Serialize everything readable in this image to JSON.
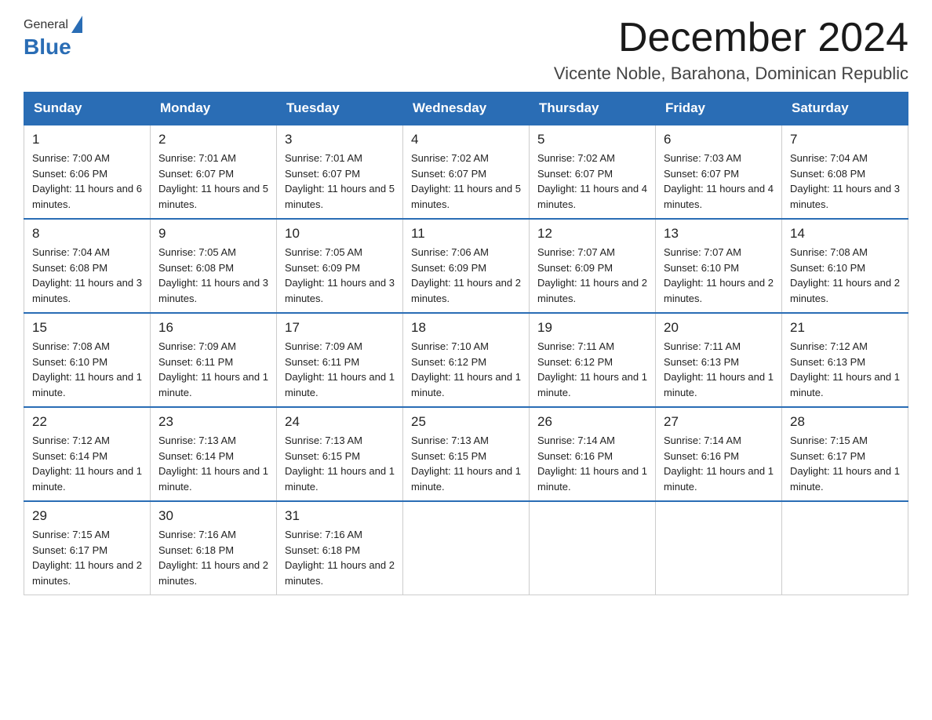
{
  "header": {
    "logo_general": "General",
    "logo_blue": "Blue",
    "month_title": "December 2024",
    "location": "Vicente Noble, Barahona, Dominican Republic"
  },
  "days_of_week": [
    "Sunday",
    "Monday",
    "Tuesday",
    "Wednesday",
    "Thursday",
    "Friday",
    "Saturday"
  ],
  "weeks": [
    [
      {
        "day": "1",
        "sunrise": "7:00 AM",
        "sunset": "6:06 PM",
        "daylight": "11 hours and 6 minutes."
      },
      {
        "day": "2",
        "sunrise": "7:01 AM",
        "sunset": "6:07 PM",
        "daylight": "11 hours and 5 minutes."
      },
      {
        "day": "3",
        "sunrise": "7:01 AM",
        "sunset": "6:07 PM",
        "daylight": "11 hours and 5 minutes."
      },
      {
        "day": "4",
        "sunrise": "7:02 AM",
        "sunset": "6:07 PM",
        "daylight": "11 hours and 5 minutes."
      },
      {
        "day": "5",
        "sunrise": "7:02 AM",
        "sunset": "6:07 PM",
        "daylight": "11 hours and 4 minutes."
      },
      {
        "day": "6",
        "sunrise": "7:03 AM",
        "sunset": "6:07 PM",
        "daylight": "11 hours and 4 minutes."
      },
      {
        "day": "7",
        "sunrise": "7:04 AM",
        "sunset": "6:08 PM",
        "daylight": "11 hours and 3 minutes."
      }
    ],
    [
      {
        "day": "8",
        "sunrise": "7:04 AM",
        "sunset": "6:08 PM",
        "daylight": "11 hours and 3 minutes."
      },
      {
        "day": "9",
        "sunrise": "7:05 AM",
        "sunset": "6:08 PM",
        "daylight": "11 hours and 3 minutes."
      },
      {
        "day": "10",
        "sunrise": "7:05 AM",
        "sunset": "6:09 PM",
        "daylight": "11 hours and 3 minutes."
      },
      {
        "day": "11",
        "sunrise": "7:06 AM",
        "sunset": "6:09 PM",
        "daylight": "11 hours and 2 minutes."
      },
      {
        "day": "12",
        "sunrise": "7:07 AM",
        "sunset": "6:09 PM",
        "daylight": "11 hours and 2 minutes."
      },
      {
        "day": "13",
        "sunrise": "7:07 AM",
        "sunset": "6:10 PM",
        "daylight": "11 hours and 2 minutes."
      },
      {
        "day": "14",
        "sunrise": "7:08 AM",
        "sunset": "6:10 PM",
        "daylight": "11 hours and 2 minutes."
      }
    ],
    [
      {
        "day": "15",
        "sunrise": "7:08 AM",
        "sunset": "6:10 PM",
        "daylight": "11 hours and 1 minute."
      },
      {
        "day": "16",
        "sunrise": "7:09 AM",
        "sunset": "6:11 PM",
        "daylight": "11 hours and 1 minute."
      },
      {
        "day": "17",
        "sunrise": "7:09 AM",
        "sunset": "6:11 PM",
        "daylight": "11 hours and 1 minute."
      },
      {
        "day": "18",
        "sunrise": "7:10 AM",
        "sunset": "6:12 PM",
        "daylight": "11 hours and 1 minute."
      },
      {
        "day": "19",
        "sunrise": "7:11 AM",
        "sunset": "6:12 PM",
        "daylight": "11 hours and 1 minute."
      },
      {
        "day": "20",
        "sunrise": "7:11 AM",
        "sunset": "6:13 PM",
        "daylight": "11 hours and 1 minute."
      },
      {
        "day": "21",
        "sunrise": "7:12 AM",
        "sunset": "6:13 PM",
        "daylight": "11 hours and 1 minute."
      }
    ],
    [
      {
        "day": "22",
        "sunrise": "7:12 AM",
        "sunset": "6:14 PM",
        "daylight": "11 hours and 1 minute."
      },
      {
        "day": "23",
        "sunrise": "7:13 AM",
        "sunset": "6:14 PM",
        "daylight": "11 hours and 1 minute."
      },
      {
        "day": "24",
        "sunrise": "7:13 AM",
        "sunset": "6:15 PM",
        "daylight": "11 hours and 1 minute."
      },
      {
        "day": "25",
        "sunrise": "7:13 AM",
        "sunset": "6:15 PM",
        "daylight": "11 hours and 1 minute."
      },
      {
        "day": "26",
        "sunrise": "7:14 AM",
        "sunset": "6:16 PM",
        "daylight": "11 hours and 1 minute."
      },
      {
        "day": "27",
        "sunrise": "7:14 AM",
        "sunset": "6:16 PM",
        "daylight": "11 hours and 1 minute."
      },
      {
        "day": "28",
        "sunrise": "7:15 AM",
        "sunset": "6:17 PM",
        "daylight": "11 hours and 1 minute."
      }
    ],
    [
      {
        "day": "29",
        "sunrise": "7:15 AM",
        "sunset": "6:17 PM",
        "daylight": "11 hours and 2 minutes."
      },
      {
        "day": "30",
        "sunrise": "7:16 AM",
        "sunset": "6:18 PM",
        "daylight": "11 hours and 2 minutes."
      },
      {
        "day": "31",
        "sunrise": "7:16 AM",
        "sunset": "6:18 PM",
        "daylight": "11 hours and 2 minutes."
      },
      null,
      null,
      null,
      null
    ]
  ]
}
